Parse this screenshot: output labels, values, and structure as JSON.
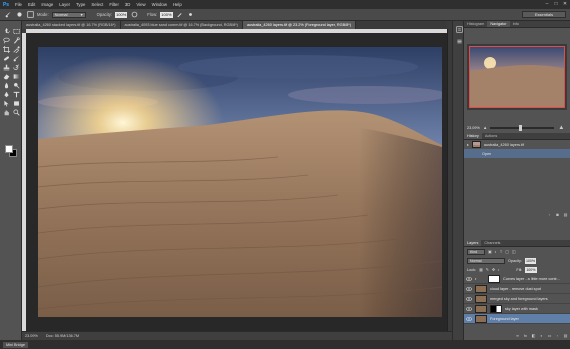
{
  "app": {
    "logo": "Ps",
    "menu": [
      "File",
      "Edit",
      "Image",
      "Layer",
      "Type",
      "Select",
      "Filter",
      "3D",
      "View",
      "Window",
      "Help"
    ],
    "window_controls": [
      "–",
      "□",
      "✕"
    ]
  },
  "options_bar": {
    "mode_label": "Mode:",
    "mode_value": "Normal",
    "opacity_label": "Opacity:",
    "opacity_value": "100%",
    "flow_label": "Flow:",
    "flow_value": "100%",
    "workspace": "Essentials"
  },
  "doc_tabs": [
    "australia_4260 stacked layers.tif @ 16.7% (RGB/16*)",
    "australia_4093 blue sand comm.tif @ 16.7% (Background, RGB/8*)",
    "australia_4260 layers.tif @ 23.2% (Foreground layer, RGB/8*)"
  ],
  "status": {
    "zoom": "23.09%",
    "doc_size": "Doc: 55.9M/136.7M"
  },
  "minibridge": {
    "tab": "Mini Bridge"
  },
  "panels": {
    "nav_tabs": [
      "Histogram",
      "Navigator",
      "Info"
    ],
    "nav_active_index": 1,
    "nav_zoom": "23.09%",
    "nav_slider_fraction": 0.47,
    "history_tabs": [
      "History",
      "Actions"
    ],
    "history_items": [
      {
        "label": "australia_4260 layers.tif",
        "selected": false
      },
      {
        "label": "Open",
        "selected": true
      }
    ],
    "layers_tabs": [
      "Layers",
      "Channels"
    ],
    "layers_kind": "Kind",
    "blend_mode": "Normal",
    "opacity_label": "Opacity:",
    "opacity_value": "100%",
    "lock_label": "Lock:",
    "fill_label": "Fill:",
    "fill_value": "100%",
    "layers": [
      {
        "name": "Curves layer - a little more contr...",
        "selected": false,
        "mask": "white"
      },
      {
        "name": "cloud layer - remove dust spot",
        "selected": false,
        "mask": "none"
      },
      {
        "name": "merged sky and foreground layers",
        "selected": false,
        "mask": "none"
      },
      {
        "name": "sky layer with mask",
        "selected": false,
        "mask": "dark"
      },
      {
        "name": "Foreground layer",
        "selected": true,
        "mask": "none"
      }
    ]
  },
  "colors": {
    "accent_selection": "#5f7fa9",
    "nav_view_box": "#e54a4a",
    "photoshop_blue": "#31a8ff"
  },
  "icons": [
    "brush-icon",
    "move-icon",
    "marquee-icon",
    "lasso-icon",
    "quick-select-icon",
    "crop-icon",
    "eyedropper-icon",
    "healing-icon",
    "brush-tool-icon",
    "stamp-icon",
    "history-brush-icon",
    "eraser-icon",
    "gradient-icon",
    "blur-icon",
    "dodge-icon",
    "pen-icon",
    "type-icon",
    "path-select-icon",
    "shape-icon",
    "hand-icon",
    "zoom-icon",
    "eye-icon"
  ]
}
